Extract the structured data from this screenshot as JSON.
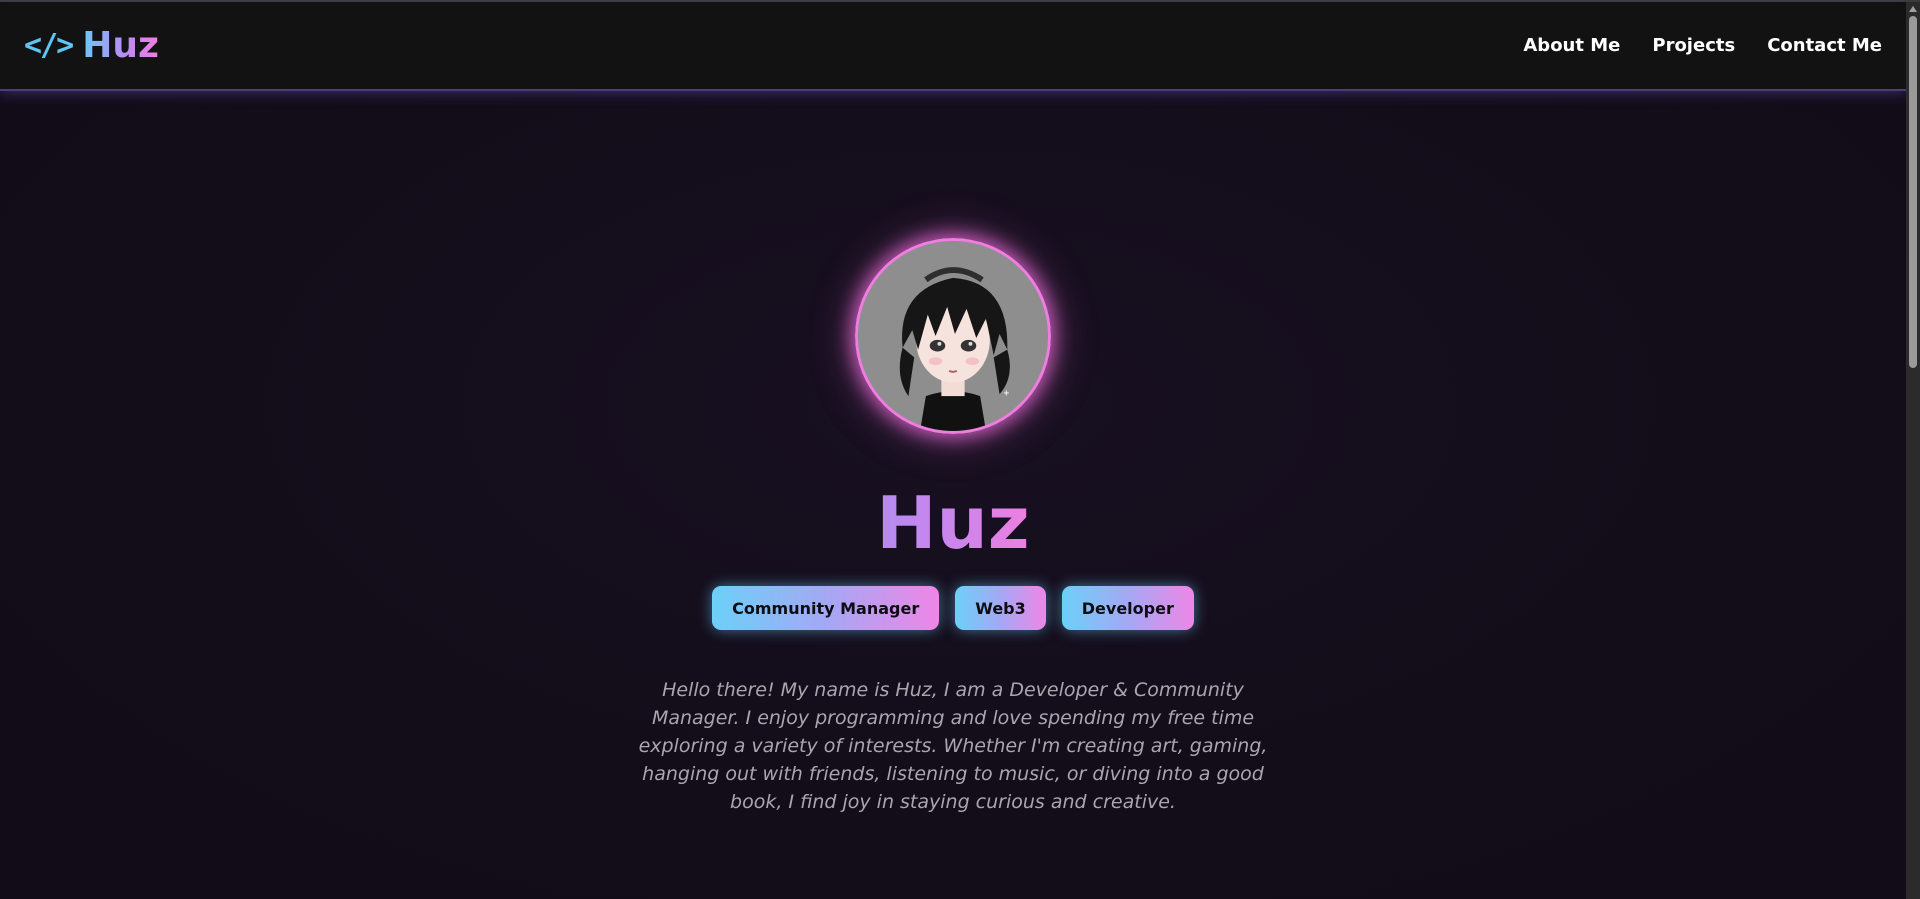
{
  "colors": {
    "background": "#130d1a",
    "navbar": "#121212",
    "accent_blue": "#6cc8f7",
    "accent_pink": "#f07de0",
    "accent_purple": "#b48bf0",
    "bio_text": "#a9a6ae"
  },
  "navbar": {
    "brand_icon": "</>",
    "brand_icon_name": "code-icon",
    "brand_name": "Huz",
    "links": [
      {
        "label": "About Me"
      },
      {
        "label": "Projects"
      },
      {
        "label": "Contact Me"
      }
    ]
  },
  "hero": {
    "avatar_icon": "anime-character-avatar",
    "name": "Huz",
    "tags": [
      {
        "label": "Community Manager"
      },
      {
        "label": "Web3"
      },
      {
        "label": "Developer"
      }
    ],
    "bio": "Hello there! My name is Huz, I am a Developer & Community Manager. I enjoy programming and love spending my free time exploring a variety of interests. Whether I'm creating art, gaming, hanging out with friends, listening to music, or diving into a good book, I find joy in staying curious and creative."
  }
}
